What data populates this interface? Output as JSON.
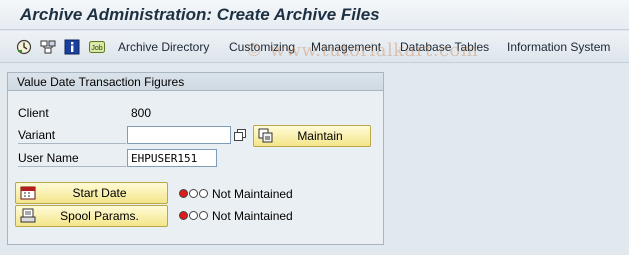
{
  "window": {
    "title": "Archive Administration: Create Archive Files"
  },
  "toolbar": {
    "icons": [
      "execute-icon",
      "hierarchy-icon",
      "info-icon",
      "job-icon"
    ],
    "job_icon_text": "Job",
    "menus": [
      "Archive Directory",
      "Customizing",
      "Management",
      "Database Tables",
      "Information System"
    ]
  },
  "watermark": "© www.tutorialkart.com",
  "group": {
    "title": "Value Date Transaction Figures",
    "client_label": "Client",
    "client_value": "800",
    "variant_label": "Variant",
    "variant_value": "",
    "user_label": "User Name",
    "user_value": "EHPUSER151",
    "maintain_button": "Maintain",
    "start_date_button": "Start Date",
    "start_date_status": "Not Maintained",
    "spool_button": "Spool Params.",
    "spool_status": "Not Maintained",
    "status_colors": {
      "red": "#e01b1b",
      "off": "#ffffff"
    }
  }
}
